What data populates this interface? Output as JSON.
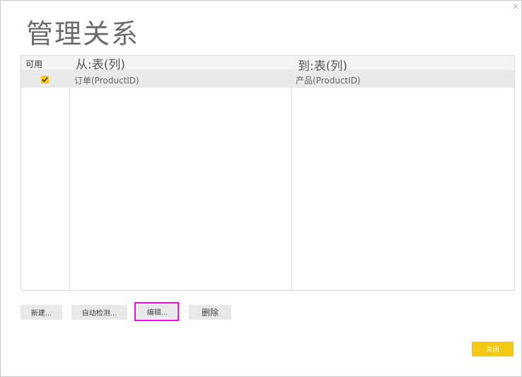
{
  "dialog": {
    "title": "管理关系",
    "close_glyph": "×"
  },
  "grid": {
    "headers": {
      "enabled": "可用",
      "from": "从:表(列)",
      "to": "到:表(列)"
    },
    "rows": [
      {
        "enabled": true,
        "from": "订单(ProductID)",
        "to": "产品(ProductID)"
      }
    ]
  },
  "buttons": {
    "new": "新建...",
    "autodetect": "自动检测...",
    "edit": "编辑...",
    "delete": "删除",
    "close": "关闭"
  },
  "colors": {
    "accent": "#f2c811",
    "highlight": "#ff00ff",
    "row_selected": "#e9e9e9",
    "title_text": "#6b6b6b"
  },
  "icons": {
    "close": "close-icon",
    "checkbox": "checkmark-icon"
  }
}
